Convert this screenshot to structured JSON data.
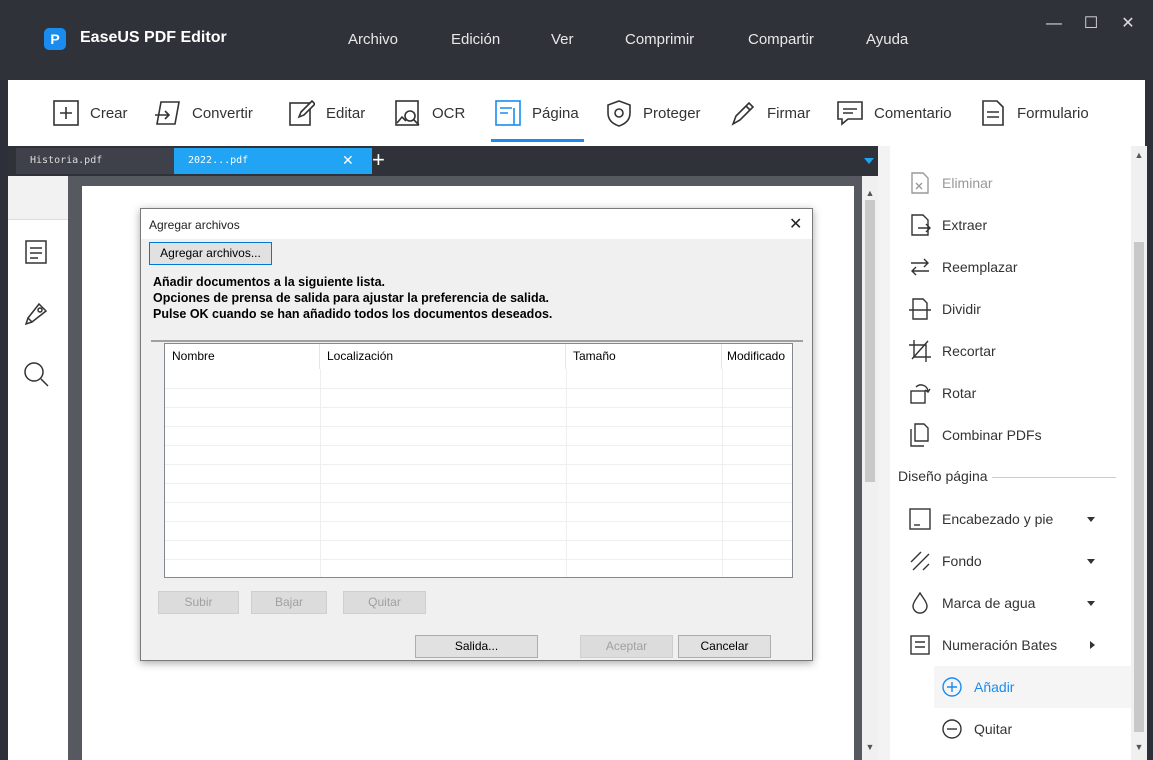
{
  "app": {
    "title": "EaseUS PDF Editor",
    "logo_letter": "P",
    "menu": [
      "Archivo",
      "Edición",
      "Ver",
      "Comprimir",
      "Compartir",
      "Ayuda"
    ],
    "window_controls": {
      "minimize": "—",
      "maximize": "☐",
      "close": "✕"
    }
  },
  "toolbar": {
    "items": [
      "Crear",
      "Convertir",
      "Editar",
      "OCR",
      "Página",
      "Proteger",
      "Firmar",
      "Comentario",
      "Formulario"
    ],
    "active": "Página",
    "accent": "#1a8cf0"
  },
  "tabs": {
    "items": [
      "Historia.pdf",
      "2022...pdf"
    ],
    "active_index": 1,
    "close_glyph": "✕",
    "add_glyph": "+"
  },
  "right_panel": {
    "items": [
      {
        "label": "Eliminar",
        "icon": "delete-page-icon",
        "disabled": true
      },
      {
        "label": "Extraer",
        "icon": "extract-page-icon"
      },
      {
        "label": "Reemplazar",
        "icon": "replace-page-icon"
      },
      {
        "label": "Dividir",
        "icon": "split-page-icon"
      },
      {
        "label": "Recortar",
        "icon": "crop-page-icon"
      },
      {
        "label": "Rotar",
        "icon": "rotate-page-icon"
      },
      {
        "label": "Combinar PDFs",
        "icon": "combine-pdfs-icon"
      }
    ],
    "section_title": "Diseño página",
    "layout_items": [
      {
        "label": "Encabezado y pie",
        "icon": "header-footer-icon",
        "arrow": "down"
      },
      {
        "label": "Fondo",
        "icon": "background-icon",
        "arrow": "down"
      },
      {
        "label": "Marca de agua",
        "icon": "watermark-icon",
        "arrow": "down"
      },
      {
        "label": "Numeración Bates",
        "icon": "bates-numbering-icon",
        "arrow": "right"
      }
    ],
    "bates_sub": [
      {
        "label": "Añadir",
        "icon": "add-circle-icon",
        "active": true
      },
      {
        "label": "Quitar",
        "icon": "remove-circle-icon"
      }
    ]
  },
  "dialog": {
    "title": "Agregar archivos",
    "close_glyph": "✕",
    "add_files_button": "Agregar archivos...",
    "instructions": [
      "Añadir documentos a la siguiente lista.",
      "Opciones de prensa de salida para ajustar la preferencia de salida.",
      "Pulse OK cuando se han añadido todos los documentos deseados."
    ],
    "columns": [
      "Nombre",
      "Localización",
      "Tamaño",
      "Modificado"
    ],
    "buttons": {
      "up": "Subir",
      "down": "Bajar",
      "remove": "Quitar",
      "output": "Salida...",
      "accept": "Aceptar",
      "cancel": "Cancelar"
    }
  }
}
